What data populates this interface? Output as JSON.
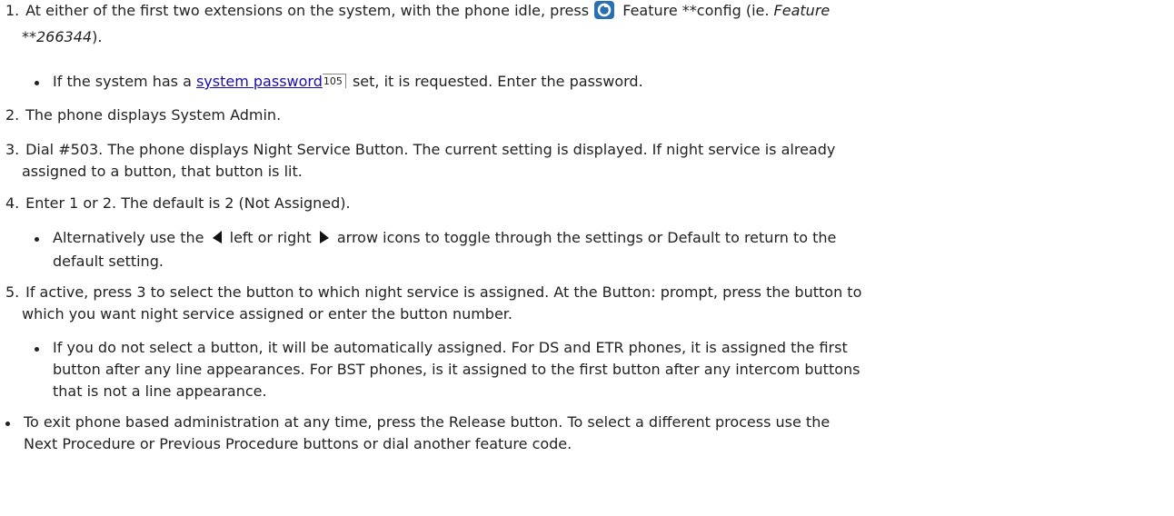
{
  "steps": [
    {
      "number": "1.",
      "line1_pre": "At either of the first two extensions on the system, with the phone idle, press",
      "icon": "feature-button-icon",
      "line1_post": " Feature **config (ie. ",
      "line1_italic": "Feature",
      "line2_italic": "**266344",
      "line2_post": ")."
    },
    {
      "number": "2.",
      "text": "The phone displays System Admin."
    },
    {
      "number": "3.",
      "line1": "Dial #503. The phone displays Night Service Button. The current setting is displayed. If night service is already",
      "line2": "assigned to a button, that button is lit."
    },
    {
      "number": "4.",
      "text": "Enter 1 or 2. The default is 2 (Not Assigned)."
    },
    {
      "number": "5.",
      "line1": "If active, press 3 to select the button to which night service is assigned. At the Button: prompt, press the button to",
      "line2": "which you want night service assigned or enter the button number."
    }
  ],
  "bullet_password": {
    "pre": "If the system has a ",
    "link": "system password",
    "page": "105",
    "post": " set, it is requested. Enter the password."
  },
  "bullet_arrows": {
    "pre": "Alternatively use the ",
    "left_icon": "left-arrow-icon",
    "mid": " left or right ",
    "right_icon": "right-arrow-icon",
    "post1": " arrow icons to toggle through the settings or Default to return to the",
    "line2": "default setting."
  },
  "bullet_assign": {
    "line1": "If you do not select a button, it will be automatically assigned. For DS and ETR phones, it is assigned the first",
    "line2": "button after any line appearances. For BST phones, is it assigned to the first button after any intercom buttons",
    "line3": "that is not a line appearance."
  },
  "bullet_exit": {
    "line1": "To exit phone based administration at any time, press the Release button. To select a different process use the",
    "line2": "Next Procedure or Previous Procedure buttons or dial another feature code."
  }
}
